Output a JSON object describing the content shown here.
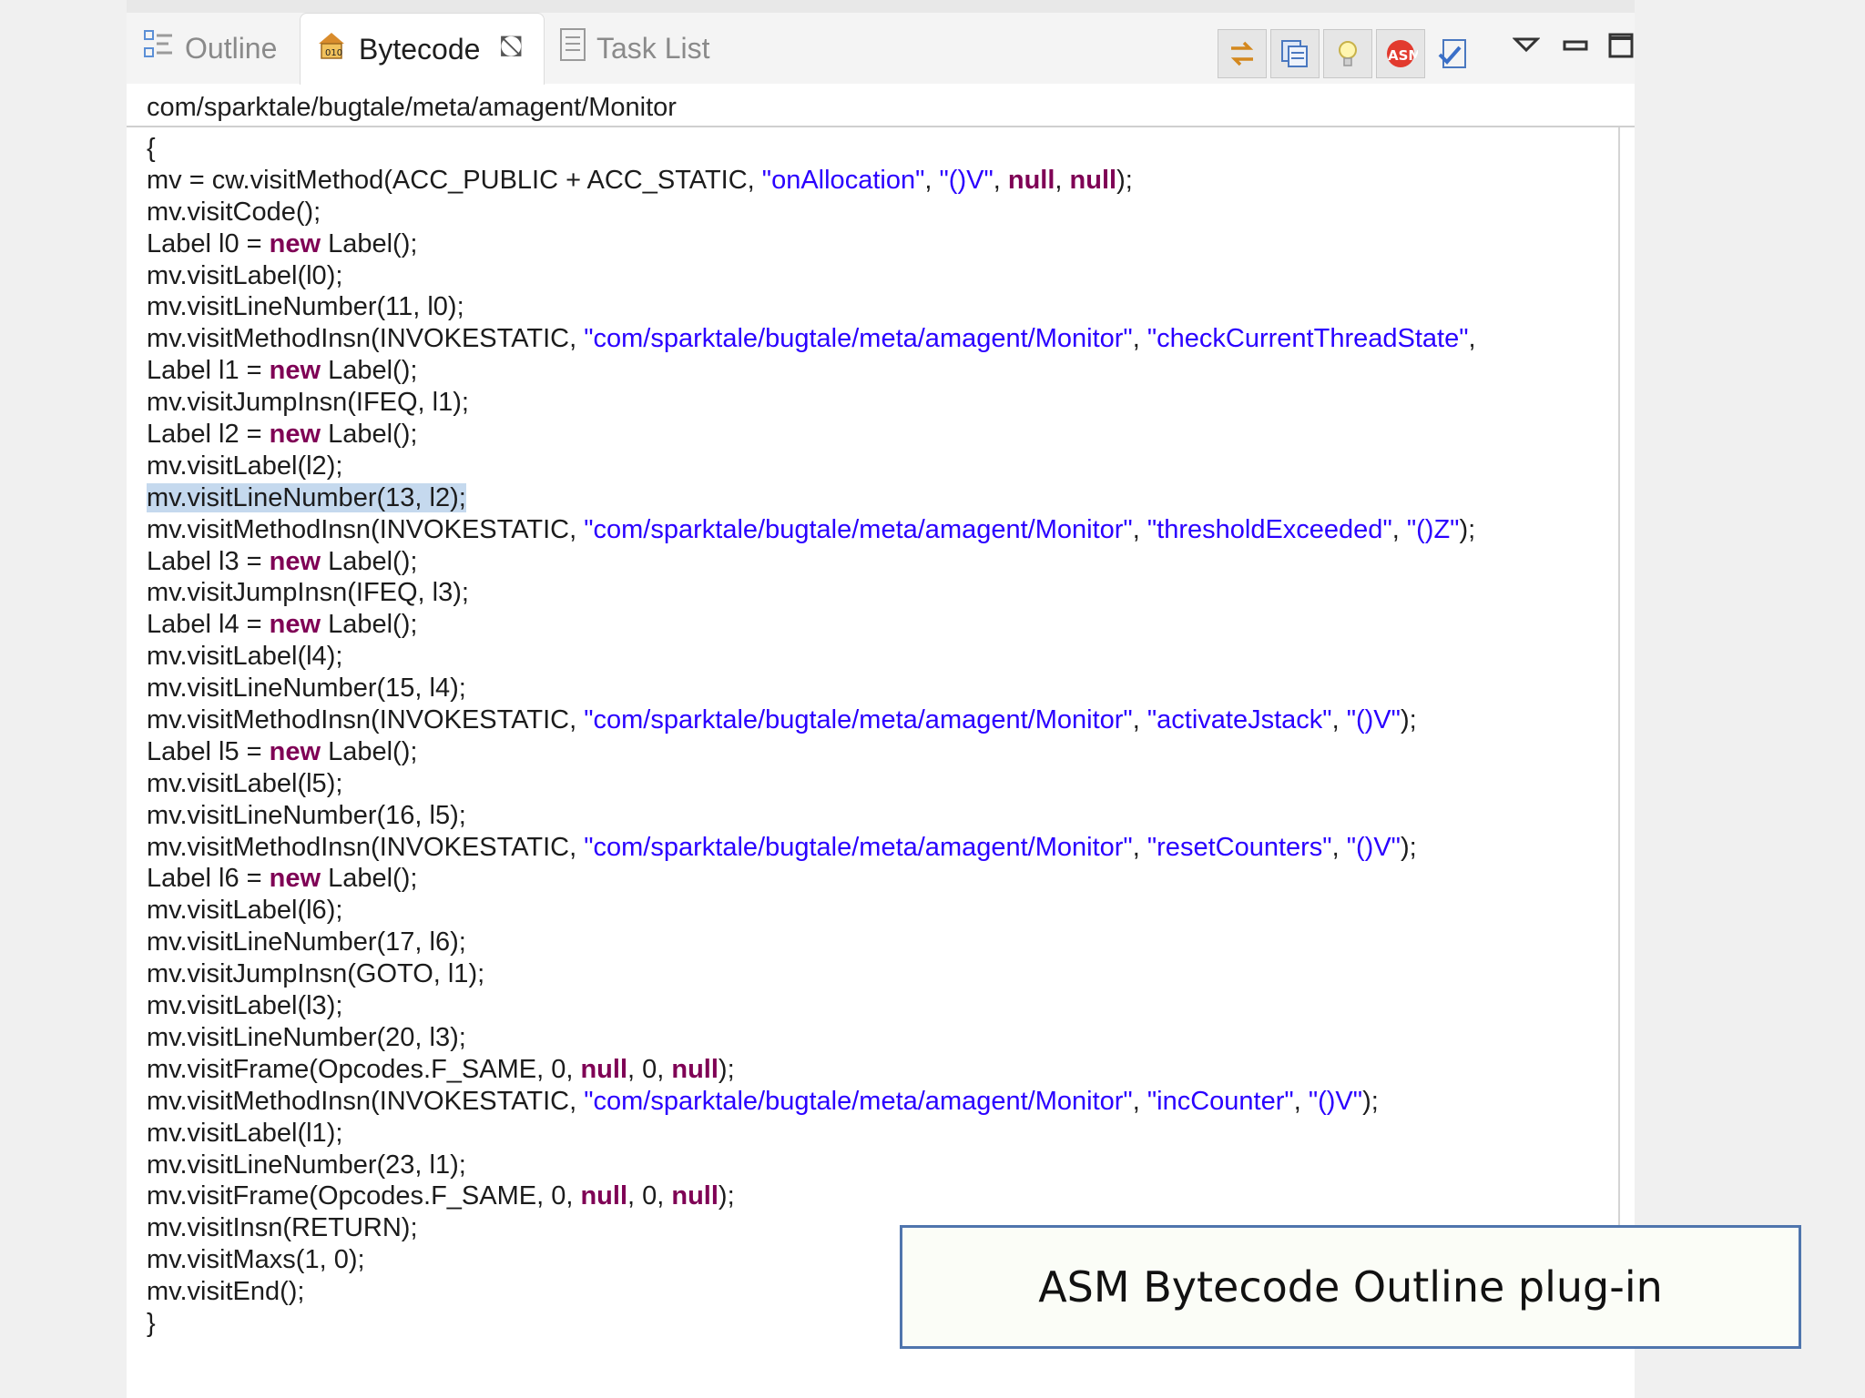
{
  "tabs": [
    {
      "label": "Outline",
      "icon": "outline-icon"
    },
    {
      "label": "Bytecode",
      "icon": "bytecode-icon",
      "close": "⛞"
    },
    {
      "label": "Task List",
      "icon": "task-list-icon"
    }
  ],
  "toolbar": {
    "buttons": [
      "link-with-editor-icon",
      "show-raw-bytecode-icon",
      "hints-icon",
      "asm-icon",
      "verify-icon"
    ],
    "view_menu": "view-menu-icon",
    "minimize": "minimize-icon",
    "maximize": "maximize-icon"
  },
  "path": "com/sparktale/bugtale/meta/amagent/Monitor",
  "code": [
    "{",
    "mv = cw.visitMethod(ACC_PUBLIC + ACC_STATIC, \"onAllocation\", \"()V\", null, null);",
    "mv.visitCode();",
    "Label l0 = new Label();",
    "mv.visitLabel(l0);",
    "mv.visitLineNumber(11, l0);",
    "mv.visitMethodInsn(INVOKESTATIC, \"com/sparktale/bugtale/meta/amagent/Monitor\", \"checkCurrentThreadState\",",
    "Label l1 = new Label();",
    "mv.visitJumpInsn(IFEQ, l1);",
    "Label l2 = new Label();",
    "mv.visitLabel(l2);",
    "mv.visitLineNumber(13, l2);",
    "mv.visitMethodInsn(INVOKESTATIC, \"com/sparktale/bugtale/meta/amagent/Monitor\", \"thresholdExceeded\", \"()Z\");",
    "Label l3 = new Label();",
    "mv.visitJumpInsn(IFEQ, l3);",
    "Label l4 = new Label();",
    "mv.visitLabel(l4);",
    "mv.visitLineNumber(15, l4);",
    "mv.visitMethodInsn(INVOKESTATIC, \"com/sparktale/bugtale/meta/amagent/Monitor\", \"activateJstack\", \"()V\");",
    "Label l5 = new Label();",
    "mv.visitLabel(l5);",
    "mv.visitLineNumber(16, l5);",
    "mv.visitMethodInsn(INVOKESTATIC, \"com/sparktale/bugtale/meta/amagent/Monitor\", \"resetCounters\", \"()V\");",
    "Label l6 = new Label();",
    "mv.visitLabel(l6);",
    "mv.visitLineNumber(17, l6);",
    "mv.visitJumpInsn(GOTO, l1);",
    "mv.visitLabel(l3);",
    "mv.visitLineNumber(20, l3);",
    "mv.visitFrame(Opcodes.F_SAME, 0, null, 0, null);",
    "mv.visitMethodInsn(INVOKESTATIC, \"com/sparktale/bugtale/meta/amagent/Monitor\", \"incCounter\", \"()V\");",
    "mv.visitLabel(l1);",
    "mv.visitLineNumber(23, l1);",
    "mv.visitFrame(Opcodes.F_SAME, 0, null, 0, null);",
    "mv.visitInsn(RETURN);",
    "mv.visitMaxs(1, 0);",
    "mv.visitEnd();",
    "}"
  ],
  "highlighted_line": "mv.visitLineNumber(13, l2);",
  "caption": "ASM Bytecode Outline plug-in",
  "colors": {
    "keyword": "#7f0055",
    "string": "#2a00ff",
    "selection": "#c5d9ee",
    "caption_border": "#4f75ad"
  }
}
